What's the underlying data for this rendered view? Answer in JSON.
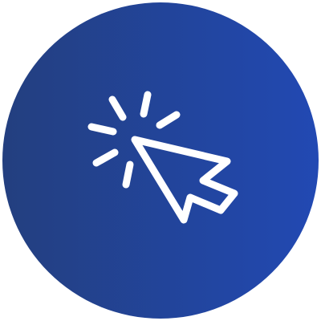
{
  "icon": {
    "name": "click-cursor-icon",
    "description_label": "",
    "colors": {
      "gradient_start": "#233f7f",
      "gradient_end": "#2249b3",
      "stroke": "#ffffff",
      "background": "#ffffff"
    }
  }
}
